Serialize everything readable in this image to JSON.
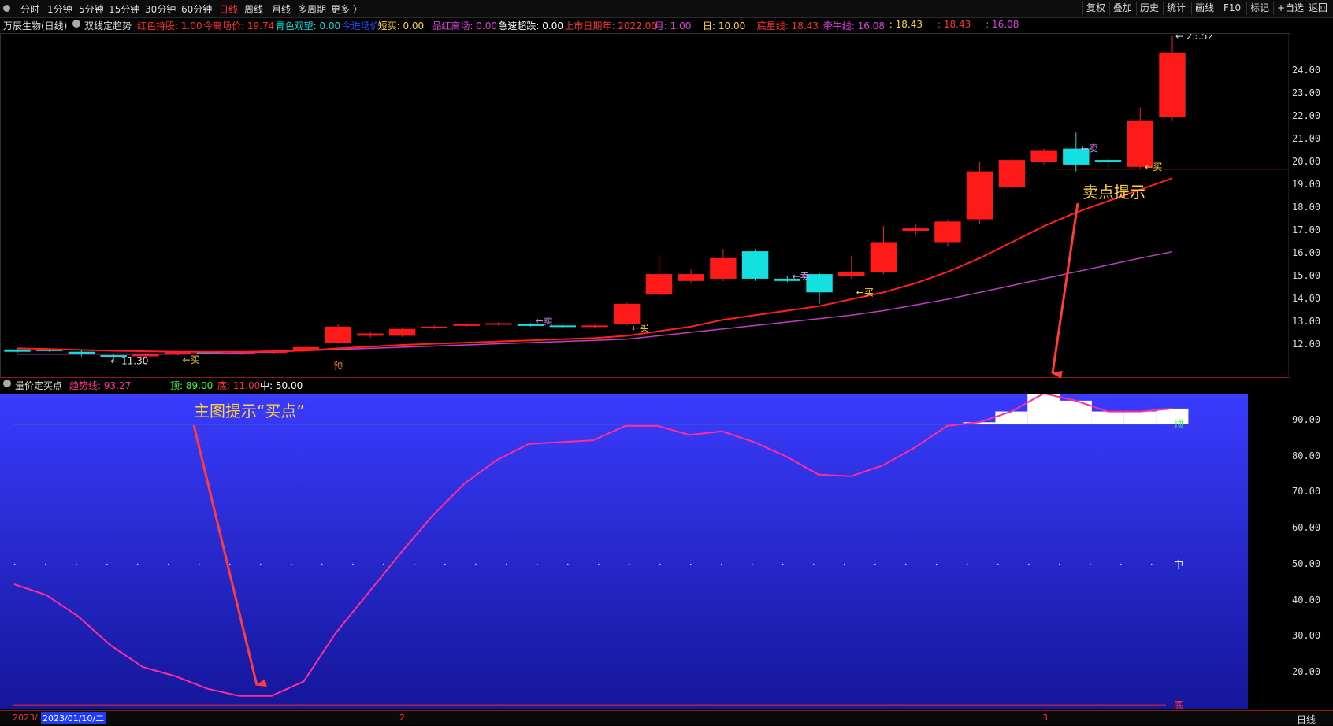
{
  "toolbar": {
    "periods": [
      "分时",
      "1分钟",
      "5分钟",
      "15分钟",
      "30分钟",
      "60分钟",
      "日线",
      "周线",
      "月线",
      "多周期",
      "更多 〉"
    ],
    "active_period": "日线",
    "right_buttons": [
      "复权",
      "叠加",
      "历史",
      "统计",
      "画线",
      "F10",
      "标记",
      "+自选",
      "返回"
    ]
  },
  "main_info": {
    "stock": "万辰生物(日线)",
    "indicator": "双线定趋势",
    "fields": [
      {
        "text": "红色持股: 1.00",
        "color": "#ff3030"
      },
      {
        "text": "今离场价: 19.74",
        "color": "#ff3030"
      },
      {
        "text": "青色观望: 0.00",
        "color": "#00e5e5"
      },
      {
        "text": "今进场价:",
        "color": "#1e50ff"
      },
      {
        "text": "短买: 0.00",
        "color": "#ffd43b"
      },
      {
        "text": "品红离场: 0.00",
        "color": "#e040e0"
      },
      {
        "text": "急速超跌: 0.00",
        "color": "#ffffff"
      },
      {
        "text": "上市日期年: 2022.00",
        "color": "#ff3030"
      },
      {
        "text": "月: 1.00",
        "color": "#e040e0"
      },
      {
        "text": "日: 10.00",
        "color": "#ffd43b"
      },
      {
        "text": "底星线: 18.43",
        "color": "#ff3030"
      },
      {
        "text": "牵牛线: 16.08",
        "color": "#e040e0"
      },
      {
        "text": ": 18.43",
        "color": "#ffd43b"
      },
      {
        "text": ": 18.43",
        "color": "#ff3030"
      },
      {
        "text": ": 16.08",
        "color": "#e040e0"
      }
    ]
  },
  "main_axis": [
    "24.00",
    "23.00",
    "22.00",
    "21.00",
    "20.00",
    "19.00",
    "18.00",
    "17.00",
    "16.00",
    "15.00",
    "14.00",
    "13.00",
    "12.00"
  ],
  "price_marks": {
    "high": "25.52",
    "low": "11.30"
  },
  "signals": {
    "buy": "买",
    "sell": "卖",
    "pre": "预"
  },
  "lower_info": {
    "title": "量价定买点",
    "fields": [
      {
        "text": "趋势线: 93.27",
        "color": "#ff3399"
      },
      {
        "text": "顶: 89.00",
        "color": "#33ff33"
      },
      {
        "text": "底: 11.00",
        "color": "#ff3030"
      },
      {
        "text": "中: 50.00",
        "color": "#ffffff"
      }
    ]
  },
  "lower_axis": [
    "90.00",
    "80.00",
    "70.00",
    "60.00",
    "50.00",
    "40.00",
    "30.00",
    "20.00"
  ],
  "lower_marks": {
    "top": "顶",
    "mid": "中",
    "bottom": "底"
  },
  "annotations": {
    "sell_hint": "卖点提示",
    "buy_hint": "主图提示“买点”"
  },
  "bottom_bar": {
    "date_left": "2023/",
    "date_cursor": "2023/01/10/二",
    "month2": "2",
    "month3": "3",
    "period": "日线"
  },
  "chart_data": {
    "type": "candlestick",
    "ylim": [
      11.5,
      25.8
    ],
    "candles": [
      [
        11.7,
        11.8,
        11.65,
        11.85,
        "cyan"
      ],
      [
        11.8,
        11.75,
        11.7,
        11.85,
        "cyan"
      ],
      [
        11.7,
        11.6,
        11.5,
        11.75,
        "cyan"
      ],
      [
        11.55,
        11.5,
        11.3,
        11.6,
        "cyan"
      ],
      [
        11.5,
        11.6,
        11.45,
        11.65,
        "red"
      ],
      [
        11.6,
        11.7,
        11.55,
        11.75,
        "red"
      ],
      [
        11.7,
        11.6,
        11.55,
        11.75,
        "cyan"
      ],
      [
        11.6,
        11.65,
        11.55,
        11.7,
        "red"
      ],
      [
        11.65,
        11.75,
        11.6,
        11.8,
        "red"
      ],
      [
        11.75,
        11.9,
        11.7,
        11.95,
        "red"
      ],
      [
        12.1,
        12.8,
        12.05,
        12.9,
        "red"
      ],
      [
        12.5,
        12.4,
        12.3,
        12.6,
        "red"
      ],
      [
        12.4,
        12.7,
        12.35,
        12.75,
        "red"
      ],
      [
        12.8,
        12.75,
        12.7,
        12.85,
        "red"
      ],
      [
        12.85,
        12.9,
        12.8,
        12.95,
        "red"
      ],
      [
        12.95,
        12.9,
        12.85,
        13.0,
        "red"
      ],
      [
        12.9,
        12.85,
        12.8,
        12.95,
        "cyan"
      ],
      [
        12.85,
        12.8,
        12.75,
        12.9,
        "cyan"
      ],
      [
        12.8,
        12.85,
        12.75,
        12.9,
        "red"
      ],
      [
        12.9,
        13.8,
        12.85,
        13.85,
        "red"
      ],
      [
        14.2,
        15.1,
        14.1,
        15.9,
        "red"
      ],
      [
        14.8,
        15.1,
        14.7,
        15.3,
        "red"
      ],
      [
        14.9,
        15.8,
        14.8,
        16.2,
        "red"
      ],
      [
        16.1,
        14.9,
        14.8,
        16.2,
        "cyan"
      ],
      [
        14.9,
        14.8,
        14.75,
        15.0,
        "cyan"
      ],
      [
        14.3,
        15.1,
        13.8,
        15.15,
        "cyan"
      ],
      [
        15.0,
        15.2,
        14.9,
        15.9,
        "red"
      ],
      [
        15.2,
        16.5,
        15.1,
        17.2,
        "red"
      ],
      [
        17.0,
        17.1,
        16.8,
        17.3,
        "red"
      ],
      [
        16.5,
        17.4,
        16.3,
        17.5,
        "red"
      ],
      [
        17.5,
        19.6,
        17.3,
        20.0,
        "red"
      ],
      [
        18.9,
        20.1,
        18.8,
        20.2,
        "red"
      ],
      [
        20.0,
        20.5,
        19.9,
        20.6,
        "red"
      ],
      [
        20.6,
        19.9,
        19.6,
        21.3,
        "cyan"
      ],
      [
        20.0,
        20.1,
        19.7,
        20.2,
        "cyan"
      ],
      [
        19.8,
        21.8,
        19.7,
        22.4,
        "red"
      ],
      [
        22.0,
        24.8,
        21.8,
        25.52,
        "red"
      ]
    ],
    "ma_red": [
      11.85,
      11.82,
      11.78,
      11.74,
      11.72,
      11.7,
      11.7,
      11.7,
      11.72,
      11.75,
      11.85,
      11.92,
      12.0,
      12.05,
      12.1,
      12.15,
      12.2,
      12.25,
      12.3,
      12.4,
      12.6,
      12.8,
      13.1,
      13.3,
      13.5,
      13.7,
      14.0,
      14.3,
      14.7,
      15.2,
      15.8,
      16.5,
      17.2,
      17.8,
      18.3,
      18.8,
      19.3
    ],
    "ma_purple": [
      11.6,
      11.6,
      11.6,
      11.6,
      11.6,
      11.6,
      11.62,
      11.65,
      11.7,
      11.75,
      11.8,
      11.85,
      11.9,
      11.95,
      12.0,
      12.05,
      12.1,
      12.15,
      12.2,
      12.25,
      12.4,
      12.55,
      12.7,
      12.85,
      13.0,
      13.15,
      13.3,
      13.5,
      13.75,
      14.0,
      14.3,
      14.6,
      14.9,
      15.2,
      15.5,
      15.8,
      16.08
    ],
    "lower": {
      "type": "line",
      "ylim": [
        11,
        98
      ],
      "top": 89,
      "mid": 50,
      "bottom": 11,
      "values": [
        44.5,
        41.5,
        35.5,
        27.5,
        21.5,
        19.0,
        15.5,
        13.5,
        13.5,
        17.5,
        31,
        42,
        53,
        63.5,
        72.5,
        79,
        83.5,
        84,
        84.5,
        88.5,
        88.5,
        86,
        87,
        84,
        80,
        75,
        74.5,
        77.5,
        82.5,
        88.5,
        89.5,
        92.5,
        97.5,
        95.5,
        92.5,
        92.5,
        93.3
      ]
    }
  }
}
